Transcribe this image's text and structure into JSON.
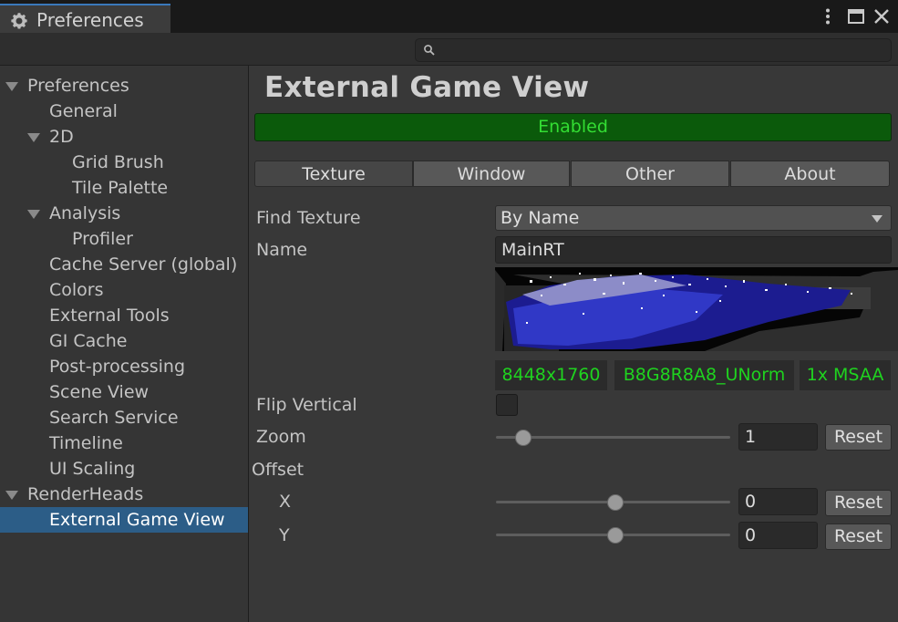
{
  "window": {
    "tab_title": "Preferences",
    "controls": [
      "more-vertical-icon",
      "maximize-icon",
      "close-icon"
    ]
  },
  "search": {
    "placeholder": ""
  },
  "sidebar": {
    "items": [
      {
        "label": "Preferences",
        "indent": 0,
        "expandable": true
      },
      {
        "label": "General",
        "indent": 1,
        "expandable": false
      },
      {
        "label": "2D",
        "indent": 1,
        "expandable": true
      },
      {
        "label": "Grid Brush",
        "indent": 2,
        "expandable": false
      },
      {
        "label": "Tile Palette",
        "indent": 2,
        "expandable": false
      },
      {
        "label": "Analysis",
        "indent": 1,
        "expandable": true
      },
      {
        "label": "Profiler",
        "indent": 2,
        "expandable": false
      },
      {
        "label": "Cache Server (global)",
        "indent": 1,
        "expandable": false
      },
      {
        "label": "Colors",
        "indent": 1,
        "expandable": false
      },
      {
        "label": "External Tools",
        "indent": 1,
        "expandable": false
      },
      {
        "label": "GI Cache",
        "indent": 1,
        "expandable": false
      },
      {
        "label": "Post-processing",
        "indent": 1,
        "expandable": false
      },
      {
        "label": "Scene View",
        "indent": 1,
        "expandable": false
      },
      {
        "label": "Search Service",
        "indent": 1,
        "expandable": false
      },
      {
        "label": "Timeline",
        "indent": 1,
        "expandable": false
      },
      {
        "label": "UI Scaling",
        "indent": 1,
        "expandable": false
      },
      {
        "label": "RenderHeads",
        "indent": 0,
        "expandable": true
      },
      {
        "label": "External Game View",
        "indent": 1,
        "expandable": false,
        "selected": true
      }
    ]
  },
  "main": {
    "title": "External Game View",
    "status": "Enabled",
    "tabs": [
      "Texture",
      "Window",
      "Other",
      "About"
    ],
    "active_tab": "Texture",
    "find_texture": {
      "label": "Find Texture",
      "value": "By Name"
    },
    "name": {
      "label": "Name",
      "value": "MainRT"
    },
    "texture_info": {
      "resolution": "8448x1760",
      "format": "B8G8R8A8_UNorm",
      "msaa": "1x MSAA"
    },
    "flip_vertical": {
      "label": "Flip Vertical",
      "checked": false
    },
    "zoom": {
      "label": "Zoom",
      "value": "1",
      "slider_fraction": 0.08,
      "reset_label": "Reset"
    },
    "offset": {
      "label": "Offset",
      "x": {
        "label": "X",
        "value": "0",
        "slider_fraction": 0.5,
        "reset_label": "Reset"
      },
      "y": {
        "label": "Y",
        "value": "0",
        "slider_fraction": 0.5,
        "reset_label": "Reset"
      }
    }
  },
  "colors": {
    "accent": "#2c5d87",
    "enabled_bg": "#0b5a0b",
    "enabled_text": "#33dd33",
    "info_text": "#1fd31f"
  }
}
